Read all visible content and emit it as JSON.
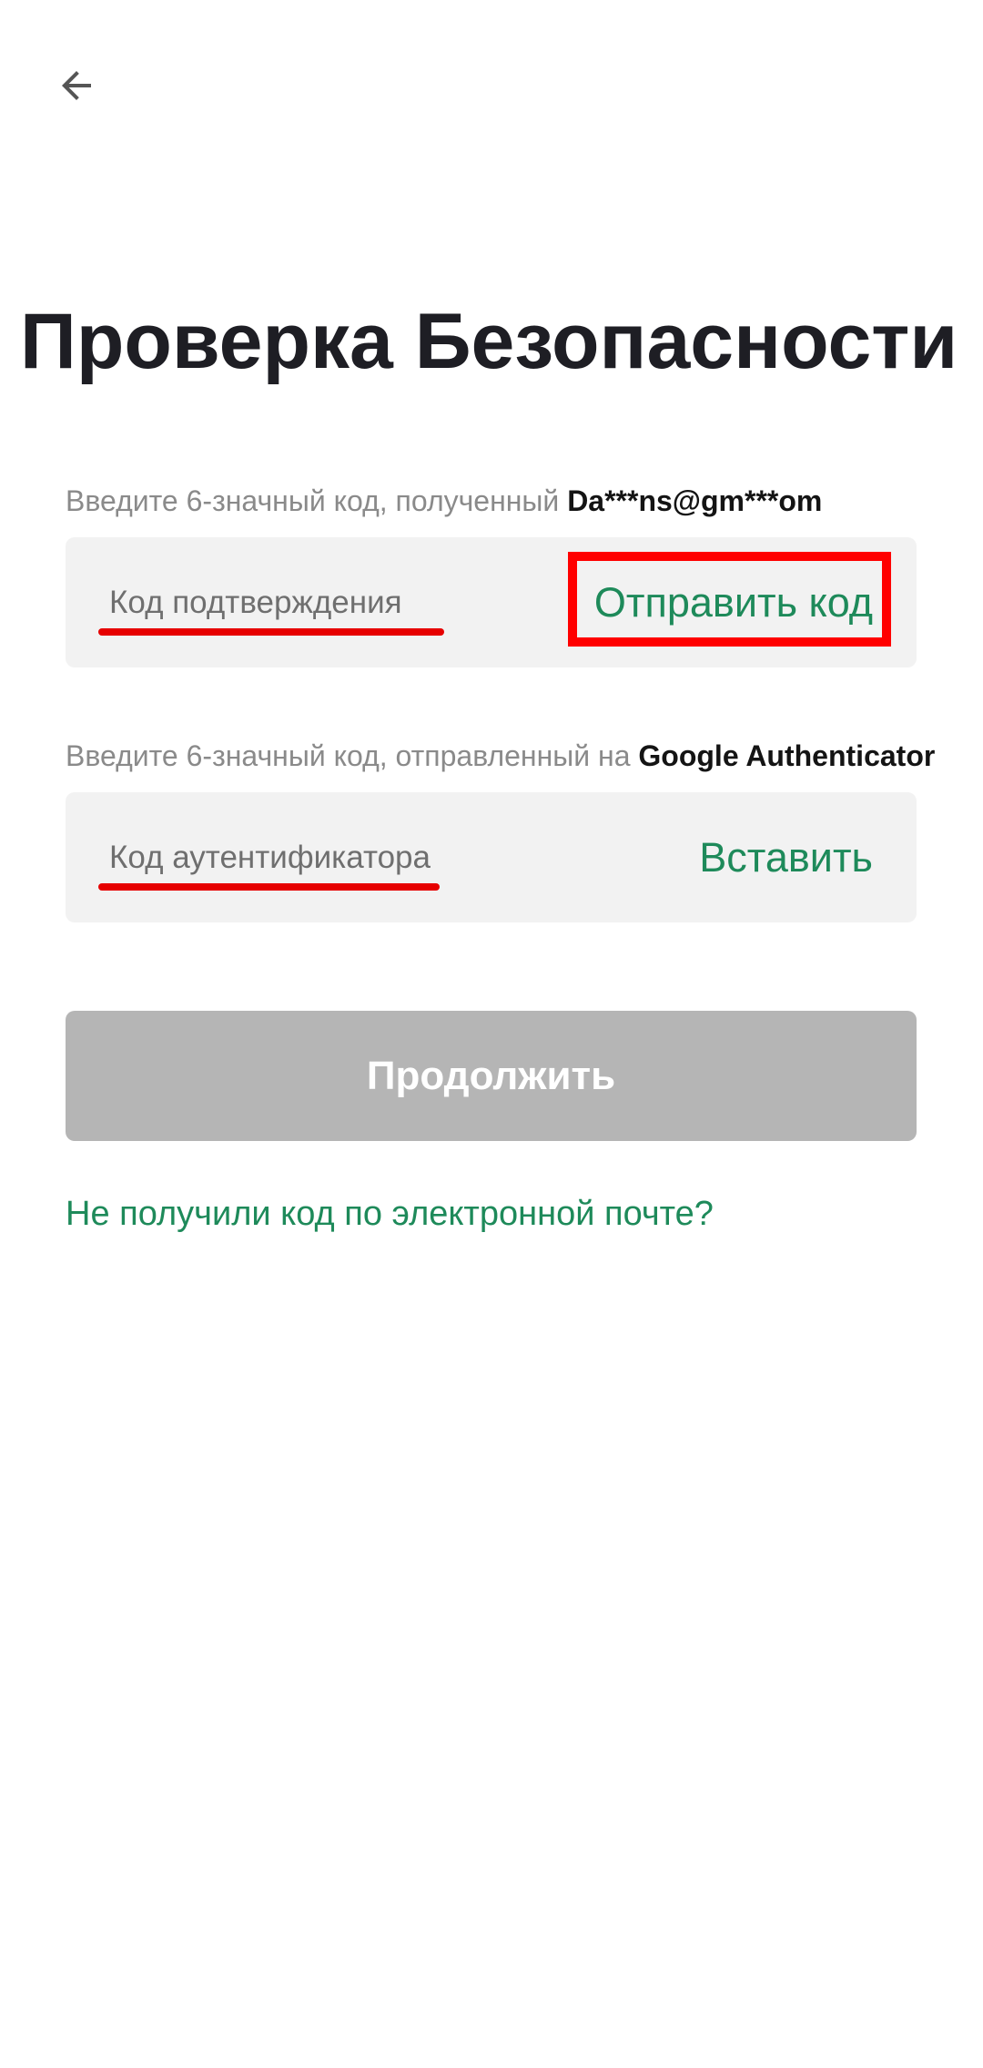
{
  "header": {
    "back_icon": "arrow-left-icon"
  },
  "page": {
    "title": "Проверка Безопасности"
  },
  "email_section": {
    "hint_prefix": "Введите 6-значный код, полученный ",
    "hint_target": "Da***ns@gm***om",
    "input_placeholder": "Код подтверждения",
    "action_label": "Отправить код"
  },
  "ga_section": {
    "hint_prefix": "Введите 6-значный код, отправленный на ",
    "hint_target": "Google Authenticator",
    "input_placeholder": "Код аутентификатора",
    "action_label": "Вставить"
  },
  "continue_button": {
    "label": "Продолжить"
  },
  "help_link": {
    "label": "Не получили код по электронной почте?"
  },
  "colors": {
    "accent": "#1e8a5a",
    "annotation": "#ff0000",
    "disabled_button": "#b5b5b5",
    "field_bg": "#f2f2f2"
  }
}
